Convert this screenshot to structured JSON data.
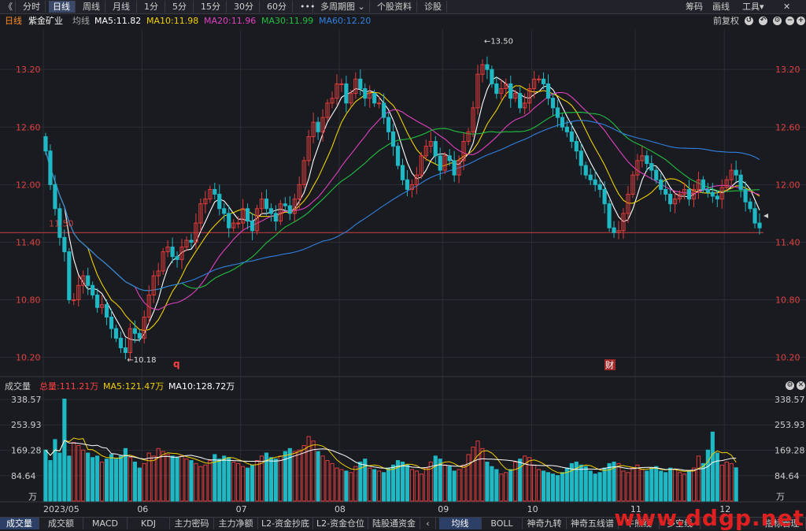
{
  "toolbar": {
    "back": "《",
    "items": [
      "分时",
      "日线",
      "周线",
      "月线",
      "1分",
      "5分",
      "15分",
      "30分",
      "60分",
      "•••",
      "多周期图 ⌄",
      "个股资料",
      "诊股"
    ],
    "active_index": 1,
    "right": [
      "筹码",
      "画线",
      "工具▾"
    ],
    "close": "✕"
  },
  "ma_bar": {
    "period": "日线",
    "stock": "紫金矿业",
    "type": "均线",
    "ma5": "MA5:11.82",
    "ma10": "MA10:11.98",
    "ma20": "MA20:11.96",
    "ma30": "MA30:11.99",
    "ma60": "MA60:12.20",
    "restore": "前复权",
    "colors": {
      "ma5": "#ffffff",
      "ma10": "#f0d000",
      "ma20": "#e040c0",
      "ma30": "#20c040",
      "ma60": "#3080e0"
    }
  },
  "volume_bar": {
    "label": "成交量",
    "total": "总量:111.21万",
    "ma5": "MA5:121.47万",
    "ma10": "MA10:128.72万"
  },
  "bottom_tabs": {
    "left": [
      "成交量",
      "成交额",
      "MACD",
      "KDJ",
      "主力密码",
      "主力净额",
      "L2-资金抄底",
      "L2-资金仓位",
      "陆股通资金"
    ],
    "right": [
      "均线",
      "BOLL",
      "神奇九转",
      "神奇五线谱",
      "牛熊线",
      "多空线",
      "指标管理"
    ],
    "active_left": 0,
    "active_right": 0
  },
  "watermark": "www.ddgp.net",
  "markers": {
    "q": "q",
    "cai": "财"
  },
  "chart_data": [
    {
      "type": "candlestick",
      "title": "紫金矿业 日线",
      "y_ticks": [
        "13.20",
        "12.60",
        "12.00",
        "11.40",
        "10.80",
        "10.20"
      ],
      "ylim": [
        10.0,
        13.62
      ],
      "x_ticks": [
        "2023/05",
        "06",
        "07",
        "08",
        "09",
        "10",
        "11",
        "12"
      ],
      "annotations": {
        "high": "13.50",
        "low": "10.18",
        "ref_line": "11.50",
        "ref_value": 11.5
      },
      "colors": {
        "up": "#e03c3c",
        "down": "#1fb8c4"
      },
      "closes": [
        12.35,
        12.0,
        11.75,
        11.45,
        11.3,
        10.8,
        10.8,
        10.95,
        11.05,
        10.95,
        10.85,
        10.72,
        10.75,
        10.62,
        10.5,
        10.4,
        10.3,
        10.25,
        10.5,
        10.45,
        10.4,
        10.62,
        10.85,
        11.05,
        11.1,
        11.3,
        11.35,
        11.25,
        11.22,
        11.35,
        11.42,
        11.4,
        11.6,
        11.8,
        11.85,
        11.95,
        11.9,
        11.75,
        11.7,
        11.55,
        11.6,
        11.6,
        11.75,
        11.62,
        11.52,
        11.75,
        11.85,
        11.75,
        11.7,
        11.62,
        11.8,
        11.78,
        11.7,
        11.85,
        12.0,
        12.25,
        12.5,
        12.65,
        12.55,
        12.7,
        12.85,
        12.9,
        13.05,
        13.05,
        12.85,
        12.95,
        13.1,
        13.0,
        12.9,
        12.95,
        12.85,
        12.85,
        12.7,
        12.55,
        12.4,
        12.2,
        12.05,
        11.95,
        12.0,
        12.1,
        12.3,
        12.4,
        12.45,
        12.3,
        12.15,
        12.3,
        12.25,
        12.1,
        12.25,
        12.45,
        12.55,
        12.8,
        13.15,
        13.25,
        13.2,
        13.05,
        12.95,
        13.0,
        13.05,
        12.9,
        12.95,
        12.8,
        12.85,
        13.0,
        13.1,
        13.1,
        13.05,
        12.9,
        12.8,
        12.7,
        12.6,
        12.55,
        12.45,
        12.35,
        12.2,
        12.1,
        12.05,
        12.0,
        11.95,
        11.8,
        11.55,
        11.5,
        11.52,
        11.7,
        11.9,
        12.1,
        12.25,
        12.3,
        12.22,
        12.15,
        12.05,
        11.95,
        11.9,
        11.8,
        11.85,
        11.9,
        11.95,
        11.85,
        11.95,
        12.05,
        11.95,
        11.92,
        11.88,
        11.85,
        11.97,
        12.05,
        12.15,
        12.1,
        11.95,
        11.82,
        11.75,
        11.6,
        11.55
      ]
    },
    {
      "type": "bar",
      "title": "成交量",
      "y_ticks": [
        "338.57",
        "253.93",
        "169.28",
        "84.64"
      ],
      "unit": "万",
      "ylim": [
        0,
        338.57
      ],
      "values": [
        170,
        135,
        205,
        160,
        340,
        150,
        195,
        185,
        170,
        160,
        145,
        150,
        130,
        140,
        155,
        140,
        150,
        175,
        145,
        130,
        110,
        125,
        160,
        150,
        175,
        165,
        155,
        150,
        145,
        150,
        140,
        135,
        125,
        115,
        120,
        135,
        155,
        140,
        150,
        145,
        130,
        125,
        115,
        110,
        120,
        135,
        150,
        160,
        145,
        140,
        150,
        165,
        175,
        165,
        170,
        185,
        215,
        200,
        165,
        150,
        135,
        125,
        110,
        105,
        100,
        95,
        115,
        130,
        140,
        110,
        105,
        100,
        95,
        110,
        120,
        135,
        130,
        120,
        105,
        100,
        90,
        110,
        130,
        150,
        140,
        120,
        115,
        100,
        105,
        120,
        155,
        180,
        200,
        175,
        130,
        115,
        105,
        90,
        95,
        105,
        130,
        140,
        150,
        145,
        120,
        105,
        100,
        95,
        90,
        85,
        95,
        110,
        125,
        130,
        120,
        115,
        100,
        90,
        95,
        110,
        125,
        130,
        125,
        100,
        95,
        110,
        120,
        105,
        100,
        110,
        115,
        100,
        95,
        110,
        105,
        95,
        90,
        100,
        110,
        150,
        125,
        170,
        230,
        160,
        120,
        130,
        125,
        111
      ]
    }
  ]
}
